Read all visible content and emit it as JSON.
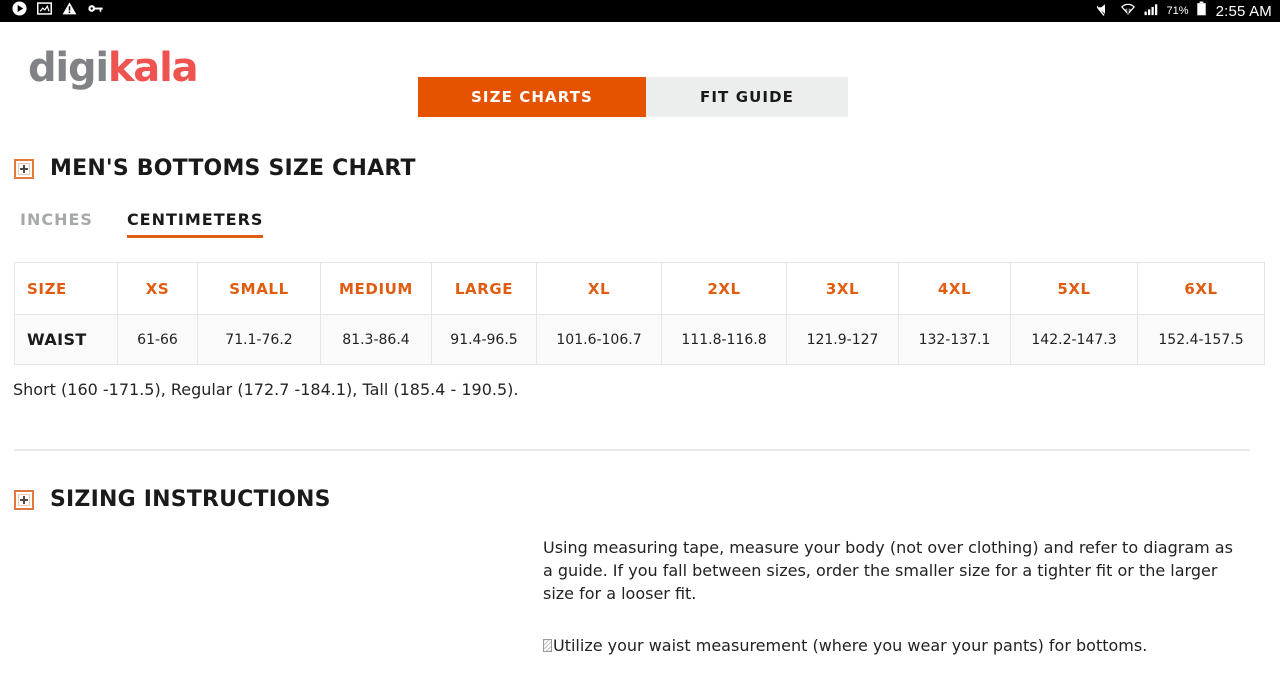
{
  "statusbar": {
    "icons_left": [
      "play-icon",
      "image-icon",
      "warning-icon",
      "key-icon"
    ],
    "icons_right": [
      "mute-icon",
      "wifi-icon",
      "cell-signal-icon",
      "battery-icon"
    ],
    "battery_percent": "71%",
    "clock": "2:55 AM"
  },
  "brand": {
    "logo_part1": "digi",
    "logo_part2": "kala",
    "logo_color1": "#808285",
    "logo_color2": "#ef5350"
  },
  "tabs": {
    "active_color": "#e55300",
    "inactive_color": "#eceded",
    "items": [
      {
        "label": "SIZE CHARTS",
        "active": true
      },
      {
        "label": "FIT GUIDE",
        "active": false
      }
    ]
  },
  "size_chart_section": {
    "title": "MEN'S BOTTOMS SIZE CHART",
    "expand_icon": "plus-box-icon",
    "unit_tabs": [
      {
        "label": "INCHES",
        "active": false
      },
      {
        "label": "CENTIMETERS",
        "active": true
      }
    ],
    "table": {
      "columns": [
        "SIZE",
        "XS",
        "SMALL",
        "MEDIUM",
        "LARGE",
        "XL",
        "2XL",
        "3XL",
        "4XL",
        "5XL",
        "6XL"
      ],
      "rows": [
        {
          "label": "WAIST",
          "values": [
            "61-66",
            "71.1-76.2",
            "81.3-86.4",
            "91.4-96.5",
            "101.6-106.7",
            "111.8-116.8",
            "121.9-127",
            "132-137.1",
            "142.2-147.3",
            "152.4-157.5"
          ]
        }
      ]
    },
    "note": "Short (160 -171.5), Regular (172.7 -184.1), Tall (185.4 - 190.5)."
  },
  "sizing_instructions_section": {
    "title": "SIZING INSTRUCTIONS",
    "expand_icon": "plus-box-icon",
    "paragraph_1": "Using measuring tape, measure your body (not over clothing) and refer to diagram as a guide. If you fall between sizes, order the smaller size for a tighter fit or the larger size for a looser fit.",
    "paragraph_2": "Utilize your waist measurement (where you wear your pants) for bottoms."
  }
}
